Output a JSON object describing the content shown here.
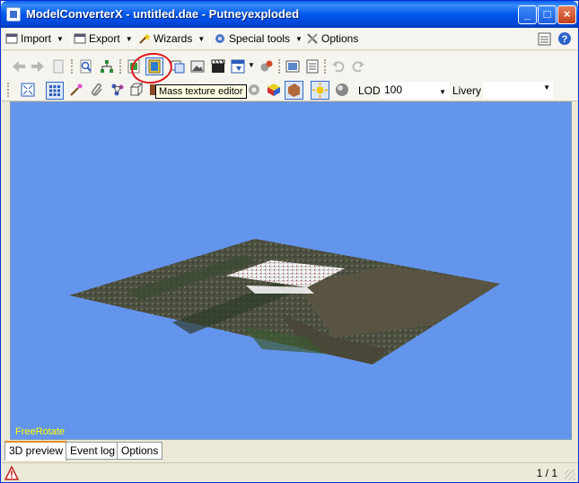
{
  "window": {
    "title": "ModelConverterX - untitled.dae - Putneyexploded"
  },
  "menubar": {
    "items": [
      {
        "label": "Import",
        "icon": "import-icon"
      },
      {
        "label": "Export",
        "icon": "export-icon"
      },
      {
        "label": "Wizards",
        "icon": "wand-icon"
      },
      {
        "label": "Special tools",
        "icon": "gear-icon"
      },
      {
        "label": "Options",
        "icon": "tools-icon"
      }
    ]
  },
  "toolbar2": {
    "lod_label": "LOD",
    "lod_value": "100",
    "livery_label": "Livery",
    "livery_value": ""
  },
  "tooltip": {
    "text": "Mass texture editor"
  },
  "viewport": {
    "mode_label": "FreeRotate",
    "background": "#6495ed"
  },
  "tabs": [
    {
      "label": "3D preview",
      "active": true
    },
    {
      "label": "Event log",
      "active": false
    },
    {
      "label": "Options",
      "active": false
    }
  ],
  "status": {
    "page": "1 / 1"
  },
  "colors": {
    "titlebar": "#0058ee",
    "annotation": "#e1171c",
    "free_rotate": "#ffff00"
  }
}
